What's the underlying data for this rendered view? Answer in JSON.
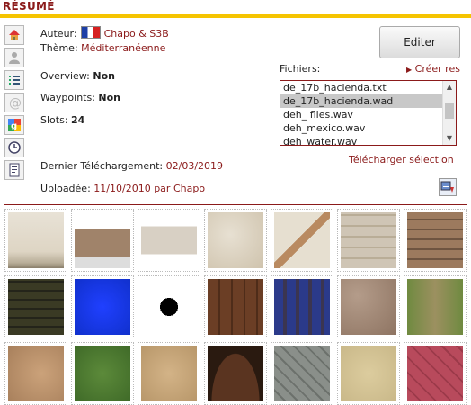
{
  "header": {
    "title": "RÉSUMÉ"
  },
  "sidebar": {
    "icons": [
      "home-icon",
      "user-icon",
      "list-icon",
      "at-icon",
      "google-icon",
      "clock-icon",
      "document-icon"
    ]
  },
  "info": {
    "auteur_label": "Auteur:",
    "auteur_value": "Chapo & S3B",
    "theme_label": "Thème:",
    "theme_value": "Méditerranéenne",
    "overview_label": "Overview:",
    "overview_value": "Non",
    "waypoints_label": "Waypoints:",
    "waypoints_value": "Non",
    "slots_label": "Slots:",
    "slots_value": "24",
    "dernier_label": "Dernier Téléchargement:",
    "dernier_value": "02/03/2019",
    "uploadee_label": "Uploadée:",
    "uploadee_value": "11/10/2010 par",
    "uploadee_user": "Chapo"
  },
  "actions": {
    "editer": "Editer",
    "fichiers_label": "Fichiers:",
    "creer": "Créer res",
    "telecharger": "Télécharger sélection"
  },
  "files": [
    "de_17b_hacienda.txt",
    "de_17b_hacienda.wad",
    "deh_ flies.wav",
    "deh_mexico.wav",
    "deh_water.wav"
  ],
  "selected_file_index": 1,
  "colors": {
    "accent": "#8b1a1a",
    "bar": "#f5c400"
  },
  "textures": [
    "plaster-wall",
    "broken-brick-wall",
    "ruined-wall-dark",
    "stained-plaster",
    "cracked-plaster",
    "stone-wall-light",
    "brown-brick",
    "dark-wood-planks",
    "blue-masked-texture",
    "black-square",
    "wooden-door",
    "blue-wood-fence",
    "cracked-mud",
    "grass-dirt",
    "dry-cracked-earth",
    "green-grass",
    "sandy-ground",
    "arched-wooden-gate",
    "gray-cobblestone",
    "pale-sand",
    "red-diamond-tile"
  ]
}
